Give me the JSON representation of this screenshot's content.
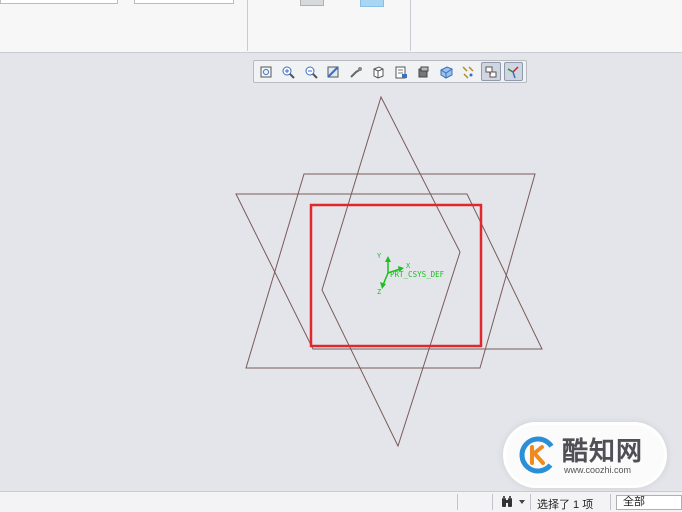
{
  "ribbon": {},
  "view_toolbar": {
    "buttons": [
      {
        "name": "refit-icon",
        "active": false
      },
      {
        "name": "zoom-in-icon",
        "active": false
      },
      {
        "name": "zoom-out-icon",
        "active": false
      },
      {
        "name": "repaint-icon",
        "active": false
      },
      {
        "name": "reorient-icon",
        "active": false
      },
      {
        "name": "saved-views-icon",
        "active": false
      },
      {
        "name": "view-manager-icon",
        "active": false
      },
      {
        "name": "display-style-icon",
        "active": false
      },
      {
        "name": "perspective-icon",
        "active": false
      },
      {
        "name": "datum-display-icon",
        "active": false
      },
      {
        "name": "annotation-display-icon",
        "active": true
      },
      {
        "name": "spin-center-icon",
        "active": true
      }
    ]
  },
  "model": {
    "csys_label": "PRT_CSYS_DEF",
    "axis_x": "X",
    "axis_y": "Y",
    "axis_z": "Z",
    "datum_color": "#7a5a5a",
    "csys_color": "#18c21a",
    "highlight_color": "#e0282c"
  },
  "statusbar": {
    "selection_text": "选择了 1 项",
    "filter_value": "全部"
  },
  "watermark": {
    "title": "酷知网",
    "url": "www.coozhi.com"
  }
}
